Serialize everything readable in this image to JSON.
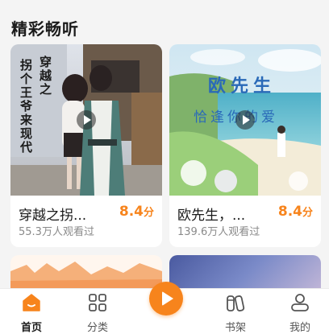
{
  "section": {
    "title": "精彩畅听"
  },
  "cards": [
    {
      "title": "穿越之拐...",
      "score": "8.4",
      "score_unit": "分",
      "views": "55.3万人观看过",
      "cover_text": [
        "穿越之",
        "拐个王爷来现代"
      ]
    },
    {
      "title": "欧先生，...",
      "score": "8.4",
      "score_unit": "分",
      "views": "139.6万人观看过",
      "cover_text": [
        "欧先生",
        "恰逢你的爱"
      ]
    }
  ],
  "tabbar": {
    "tabs": [
      {
        "label": "首页",
        "icon": "home-icon",
        "active": true
      },
      {
        "label": "分类",
        "icon": "grid-icon",
        "active": false
      },
      {
        "label": "",
        "icon": "play-icon",
        "active": false
      },
      {
        "label": "书架",
        "icon": "bookshelf-icon",
        "active": false
      },
      {
        "label": "我的",
        "icon": "profile-icon",
        "active": false
      }
    ]
  },
  "colors": {
    "accent": "#f7841c",
    "background": "#f4f4f4",
    "card": "#ffffff",
    "text": "#1a1a1a",
    "muted": "#8a8a8a"
  }
}
